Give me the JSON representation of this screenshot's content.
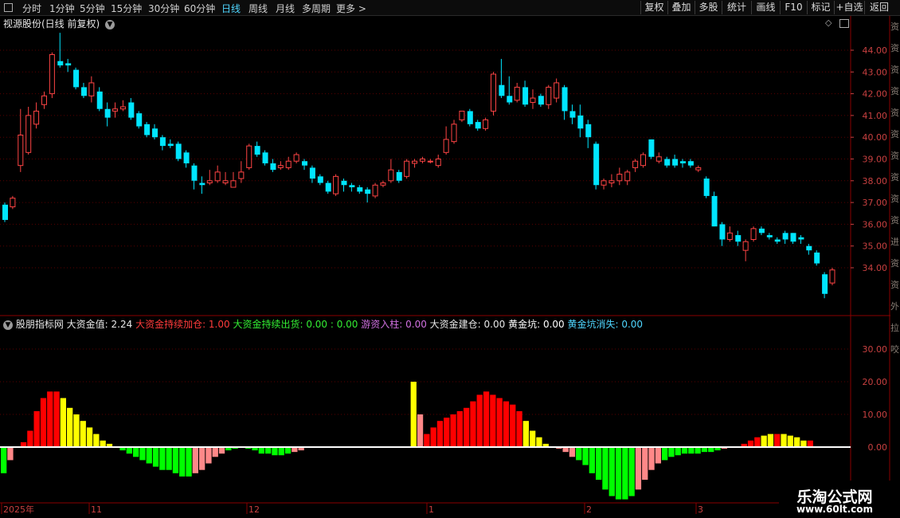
{
  "toolbar": {
    "periods": [
      {
        "label": "分时",
        "active": false
      },
      {
        "label": "1分钟",
        "active": false
      },
      {
        "label": "5分钟",
        "active": false
      },
      {
        "label": "15分钟",
        "active": false
      },
      {
        "label": "30分钟",
        "active": false
      },
      {
        "label": "60分钟",
        "active": false
      },
      {
        "label": "日线",
        "active": true
      },
      {
        "label": "周线",
        "active": false
      },
      {
        "label": "月线",
        "active": false
      },
      {
        "label": "多周期",
        "active": false
      },
      {
        "label": "更多 >",
        "active": false
      }
    ],
    "right_buttons": [
      "复权",
      "叠加",
      "多股",
      "统计",
      "画线",
      "F10",
      "标记",
      "+自选",
      "返回"
    ]
  },
  "main_panel": {
    "title": "视源股份(日线 前复权)",
    "price_ticks": [
      "44.00",
      "43.00",
      "42.00",
      "41.00",
      "40.00",
      "39.00",
      "38.00",
      "37.00",
      "36.00",
      "35.00",
      "34.00"
    ]
  },
  "indicator_panel": {
    "name": "股朋指标网",
    "items": [
      {
        "label": "大资金值: 2.24",
        "color": "#e8e8e8"
      },
      {
        "label": "大资金持续加仓: 1.00",
        "color": "#ff3b3b"
      },
      {
        "label": "大资金持续出货: 0.00 : 0.00",
        "color": "#33ee33"
      },
      {
        "label": "游资入柱: 0.00",
        "color": "#d070e0"
      },
      {
        "label": "大资金建仓: 0.00",
        "color": "#e8e8e8"
      },
      {
        "label": "黄金坑: 0.00",
        "color": "#ffffff"
      },
      {
        "label": "黄金坑消失: 0.00",
        "color": "#4fd6ff"
      }
    ],
    "value_ticks": [
      "30.00",
      "20.00",
      "10.00",
      "0.00"
    ]
  },
  "date_axis": [
    "2025年",
    "11",
    "12",
    "1",
    "2",
    "3"
  ],
  "right_strip_chars": [
    "资",
    "资",
    "资",
    "资",
    "资",
    "资",
    "资",
    "资",
    "资",
    "资",
    "进",
    "资",
    "资",
    "外",
    "拉",
    "咬"
  ],
  "colors": {
    "up": "#ff4444",
    "down": "#00e5ff",
    "bar_red": "#ff0000",
    "bar_yellow": "#ffff00",
    "bar_pink": "#ff8888",
    "bar_green": "#00ff00",
    "grid": "#5a0000"
  },
  "watermark": {
    "line1": "乐淘公式网",
    "line2": "www.60lt.com"
  },
  "chart_data": [
    {
      "type": "candlestick",
      "title": "视源股份(日线 前复权)",
      "ylim": [
        33.0,
        45.0
      ],
      "candles": [
        [
          36.9,
          36.2,
          37.0,
          36.1
        ],
        [
          36.8,
          37.2,
          37.3,
          36.7
        ],
        [
          38.7,
          40.1,
          41.3,
          38.4
        ],
        [
          39.3,
          41.0,
          41.4,
          39.2
        ],
        [
          40.6,
          41.2,
          41.6,
          40.4
        ],
        [
          41.5,
          41.9,
          42.1,
          41.3
        ],
        [
          42.0,
          43.8,
          43.9,
          41.8
        ],
        [
          43.5,
          43.3,
          44.8,
          43.2
        ],
        [
          43.4,
          43.3,
          43.6,
          43.0
        ],
        [
          43.1,
          42.3,
          43.2,
          42.2
        ],
        [
          42.3,
          41.9,
          42.5,
          41.8
        ],
        [
          41.9,
          42.5,
          42.8,
          41.6
        ],
        [
          42.1,
          41.3,
          42.3,
          41.2
        ],
        [
          41.3,
          40.9,
          41.6,
          40.5
        ],
        [
          41.2,
          41.3,
          41.6,
          40.9
        ],
        [
          41.3,
          41.4,
          41.7,
          41.2
        ],
        [
          41.6,
          40.9,
          41.8,
          40.8
        ],
        [
          41.1,
          40.5,
          41.2,
          40.4
        ],
        [
          40.6,
          40.1,
          40.7,
          40.0
        ],
        [
          40.4,
          40.0,
          40.6,
          39.9
        ],
        [
          40.0,
          39.6,
          40.1,
          39.4
        ],
        [
          39.7,
          39.6,
          39.9,
          39.5
        ],
        [
          39.7,
          39.0,
          39.8,
          38.9
        ],
        [
          39.3,
          38.8,
          39.4,
          38.6
        ],
        [
          38.7,
          38.0,
          38.8,
          37.6
        ],
        [
          37.9,
          37.8,
          38.2,
          37.4
        ],
        [
          37.9,
          38.0,
          38.5,
          37.8
        ],
        [
          38.0,
          38.4,
          38.7,
          37.9
        ],
        [
          37.9,
          38.0,
          38.4,
          37.8
        ],
        [
          37.7,
          38.0,
          38.4,
          37.7
        ],
        [
          38.1,
          38.4,
          38.9,
          37.9
        ],
        [
          38.6,
          39.6,
          39.7,
          38.5
        ],
        [
          39.6,
          39.2,
          39.8,
          39.1
        ],
        [
          39.3,
          38.8,
          39.4,
          38.7
        ],
        [
          38.8,
          38.5,
          39.0,
          38.4
        ],
        [
          38.6,
          38.7,
          38.9,
          38.5
        ],
        [
          38.6,
          38.9,
          39.1,
          38.5
        ],
        [
          38.9,
          39.2,
          39.3,
          38.8
        ],
        [
          38.9,
          38.7,
          39.0,
          38.5
        ],
        [
          38.6,
          38.1,
          38.7,
          37.9
        ],
        [
          38.2,
          37.9,
          38.3,
          37.8
        ],
        [
          37.9,
          37.5,
          38.0,
          37.4
        ],
        [
          37.4,
          38.2,
          38.3,
          37.3
        ],
        [
          38.0,
          37.8,
          38.1,
          37.5
        ],
        [
          37.8,
          37.7,
          37.9,
          37.5
        ],
        [
          37.7,
          37.5,
          37.8,
          37.4
        ],
        [
          37.6,
          37.4,
          37.7,
          37.0
        ],
        [
          37.3,
          37.8,
          37.9,
          37.2
        ],
        [
          37.8,
          37.9,
          38.0,
          37.7
        ],
        [
          38.0,
          38.5,
          39.0,
          37.9
        ],
        [
          38.4,
          38.0,
          38.5,
          37.9
        ],
        [
          38.2,
          38.9,
          39.0,
          38.1
        ],
        [
          38.8,
          38.9,
          39.0,
          38.6
        ],
        [
          38.9,
          39.0,
          39.1,
          38.8
        ],
        [
          38.9,
          38.9,
          39.0,
          38.8
        ],
        [
          38.7,
          39.0,
          39.2,
          38.6
        ],
        [
          39.3,
          39.9,
          40.5,
          39.2
        ],
        [
          39.8,
          40.6,
          40.8,
          39.7
        ],
        [
          40.8,
          41.2,
          41.2,
          40.7
        ],
        [
          41.2,
          40.6,
          41.3,
          40.5
        ],
        [
          40.7,
          40.4,
          40.8,
          40.3
        ],
        [
          40.4,
          40.8,
          40.9,
          40.3
        ],
        [
          41.2,
          42.9,
          43.0,
          41.0
        ],
        [
          42.4,
          41.9,
          43.6,
          41.8
        ],
        [
          41.9,
          41.6,
          42.8,
          41.5
        ],
        [
          41.7,
          42.3,
          42.5,
          41.6
        ],
        [
          42.3,
          41.5,
          42.6,
          41.4
        ],
        [
          41.6,
          41.8,
          42.2,
          41.3
        ],
        [
          41.9,
          41.5,
          42.0,
          41.4
        ],
        [
          41.5,
          42.3,
          42.4,
          41.3
        ],
        [
          41.8,
          42.5,
          42.7,
          41.6
        ],
        [
          42.3,
          41.2,
          42.4,
          40.8
        ],
        [
          41.2,
          40.9,
          41.5,
          40.6
        ],
        [
          41.0,
          40.4,
          41.5,
          40.0
        ],
        [
          40.6,
          40.0,
          40.8,
          39.5
        ],
        [
          39.7,
          37.8,
          39.8,
          37.6
        ],
        [
          37.8,
          38.0,
          38.1,
          37.6
        ],
        [
          37.9,
          38.0,
          38.3,
          37.7
        ],
        [
          38.0,
          38.3,
          38.6,
          37.8
        ],
        [
          38.0,
          38.4,
          38.5,
          37.8
        ],
        [
          38.6,
          38.9,
          39.0,
          38.4
        ],
        [
          38.7,
          39.2,
          39.3,
          38.6
        ],
        [
          39.9,
          39.1,
          39.9,
          39.0
        ],
        [
          38.9,
          39.1,
          39.3,
          38.8
        ],
        [
          39.0,
          38.7,
          39.1,
          38.6
        ],
        [
          39.0,
          38.7,
          39.2,
          38.6
        ],
        [
          38.9,
          38.8,
          39.0,
          38.6
        ],
        [
          38.9,
          38.7,
          39.0,
          38.6
        ],
        [
          38.5,
          38.6,
          38.7,
          38.4
        ],
        [
          38.1,
          37.3,
          38.2,
          37.2
        ],
        [
          37.3,
          35.9,
          37.5,
          35.9
        ],
        [
          36.0,
          35.3,
          36.1,
          35.0
        ],
        [
          35.3,
          35.6,
          35.9,
          35.2
        ],
        [
          35.5,
          35.2,
          35.7,
          35.0
        ],
        [
          34.8,
          35.2,
          35.3,
          34.3
        ],
        [
          35.3,
          35.8,
          35.9,
          35.2
        ],
        [
          35.8,
          35.6,
          35.9,
          35.5
        ],
        [
          35.5,
          35.4,
          35.6,
          35.3
        ],
        [
          35.3,
          35.2,
          35.4,
          35.1
        ],
        [
          35.6,
          35.3,
          35.7,
          35.1
        ],
        [
          35.6,
          35.2,
          35.6,
          35.1
        ],
        [
          35.4,
          35.3,
          35.5,
          35.1
        ],
        [
          35.0,
          34.8,
          35.1,
          34.6
        ],
        [
          34.7,
          34.2,
          34.8,
          34.1
        ],
        [
          33.7,
          32.8,
          33.8,
          32.6
        ],
        [
          33.3,
          33.9,
          34.0,
          33.2
        ]
      ]
    },
    {
      "type": "bar",
      "title": "股朋指标网",
      "ylim": [
        -17,
        38
      ],
      "values": [
        -8,
        -4,
        0,
        1.5,
        5,
        11,
        15,
        17,
        17,
        15,
        12,
        10,
        8,
        6,
        4,
        2,
        1,
        0,
        -1,
        -2,
        -3,
        -4,
        -5,
        -6,
        -7,
        -7,
        -8,
        -9,
        -9,
        -8,
        -7,
        -5,
        -3,
        -2,
        -1,
        -0.5,
        0,
        -0.5,
        -1,
        -2,
        -2,
        -2.5,
        -2.5,
        -2,
        -1.5,
        -1,
        0,
        0,
        0,
        0,
        0,
        0,
        0,
        0,
        0,
        0,
        0,
        0,
        0,
        0,
        0,
        0,
        20,
        10,
        4,
        6,
        8,
        9,
        10,
        11,
        12,
        14,
        16,
        17,
        16,
        15,
        14,
        13,
        11,
        8,
        5,
        3,
        1,
        0,
        -0.5,
        -1.5,
        -3,
        -4,
        -5.5,
        -8,
        -10,
        -13,
        -15,
        -16,
        -16,
        -15,
        -13,
        -10,
        -7,
        -5,
        -4,
        -3,
        -2.5,
        -2,
        -2,
        -2,
        -1.5,
        -1.5,
        -1,
        -0.5,
        0,
        0,
        1,
        2,
        3,
        3.5,
        4,
        4,
        4,
        3.5,
        3,
        2,
        2
      ],
      "colors": [
        "green",
        "pink",
        "green",
        "red",
        "red",
        "red",
        "red",
        "red",
        "red",
        "yellow",
        "yellow",
        "yellow",
        "yellow",
        "yellow",
        "yellow",
        "yellow",
        "yellow",
        "green",
        "green",
        "green",
        "green",
        "green",
        "green",
        "green",
        "green",
        "green",
        "green",
        "green",
        "green",
        "pink",
        "pink",
        "pink",
        "pink",
        "pink",
        "green",
        "green",
        "green",
        "green",
        "green",
        "green",
        "green",
        "green",
        "green",
        "green",
        "pink",
        "pink",
        "pink",
        "green",
        "green",
        "green",
        "green",
        "green",
        "green",
        "green",
        "green",
        "green",
        "green",
        "green",
        "green",
        "green",
        "green",
        "green",
        "yellow",
        "pink",
        "red",
        "red",
        "red",
        "red",
        "red",
        "red",
        "red",
        "red",
        "red",
        "red",
        "red",
        "red",
        "red",
        "red",
        "red",
        "yellow",
        "yellow",
        "yellow",
        "yellow",
        "green",
        "pink",
        "pink",
        "pink",
        "green",
        "green",
        "green",
        "green",
        "green",
        "green",
        "green",
        "green",
        "green",
        "pink",
        "pink",
        "pink",
        "pink",
        "green",
        "green",
        "green",
        "green",
        "green",
        "green",
        "green",
        "green",
        "green",
        "pink",
        "pink",
        "green",
        "red",
        "red",
        "red",
        "yellow",
        "yellow",
        "red",
        "yellow",
        "yellow",
        "yellow",
        "yellow",
        "red"
      ]
    }
  ]
}
